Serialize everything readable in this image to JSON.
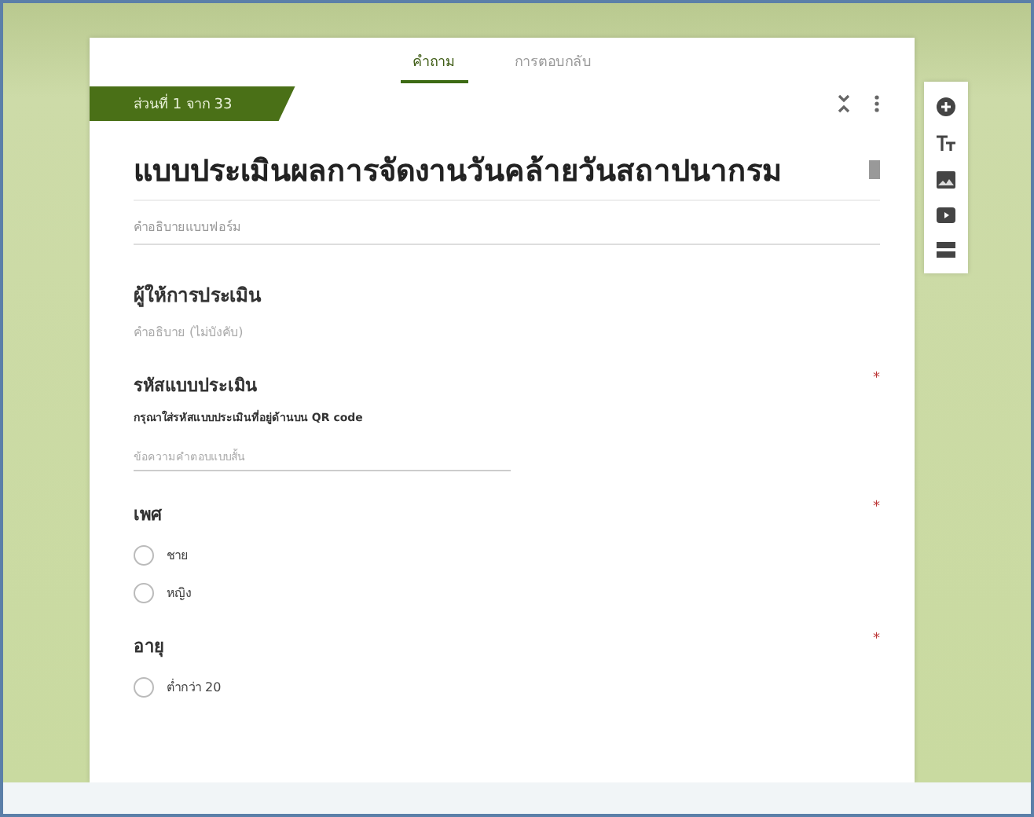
{
  "tabs": [
    {
      "label": "คำถาม",
      "selected": true
    },
    {
      "label": "การตอบกลับ",
      "selected": false
    }
  ],
  "section_badge": "ส่วนที่ 1 จาก 33",
  "form_title": "แบบประเมินผลการจัดงานวันคล้ายวันสถาปนากรม",
  "form_description": "คำอธิบายแบบฟอร์ม",
  "items": [
    {
      "kind": "header",
      "title": "ผู้ให้การประเมิน",
      "description": "คำอธิบาย (ไม่บังคับ)"
    },
    {
      "kind": "short",
      "title": "รหัสแบบประเมิน",
      "required_mark": "*",
      "description": "กรุณาใส่รหัสแบบประเมินที่อยู่ด้านบน QR code",
      "placeholder": "ข้อความคำตอบแบบสั้น"
    },
    {
      "kind": "choice",
      "title": "เพศ",
      "required_mark": "*",
      "options": [
        {
          "label": "ชาย",
          "selected": false
        },
        {
          "label": "หญิง",
          "selected": false
        }
      ]
    },
    {
      "kind": "choice",
      "title": "อายุ",
      "required_mark": "*",
      "options": [
        {
          "label": "ต่ำกว่า 20",
          "selected": false
        }
      ]
    }
  ]
}
